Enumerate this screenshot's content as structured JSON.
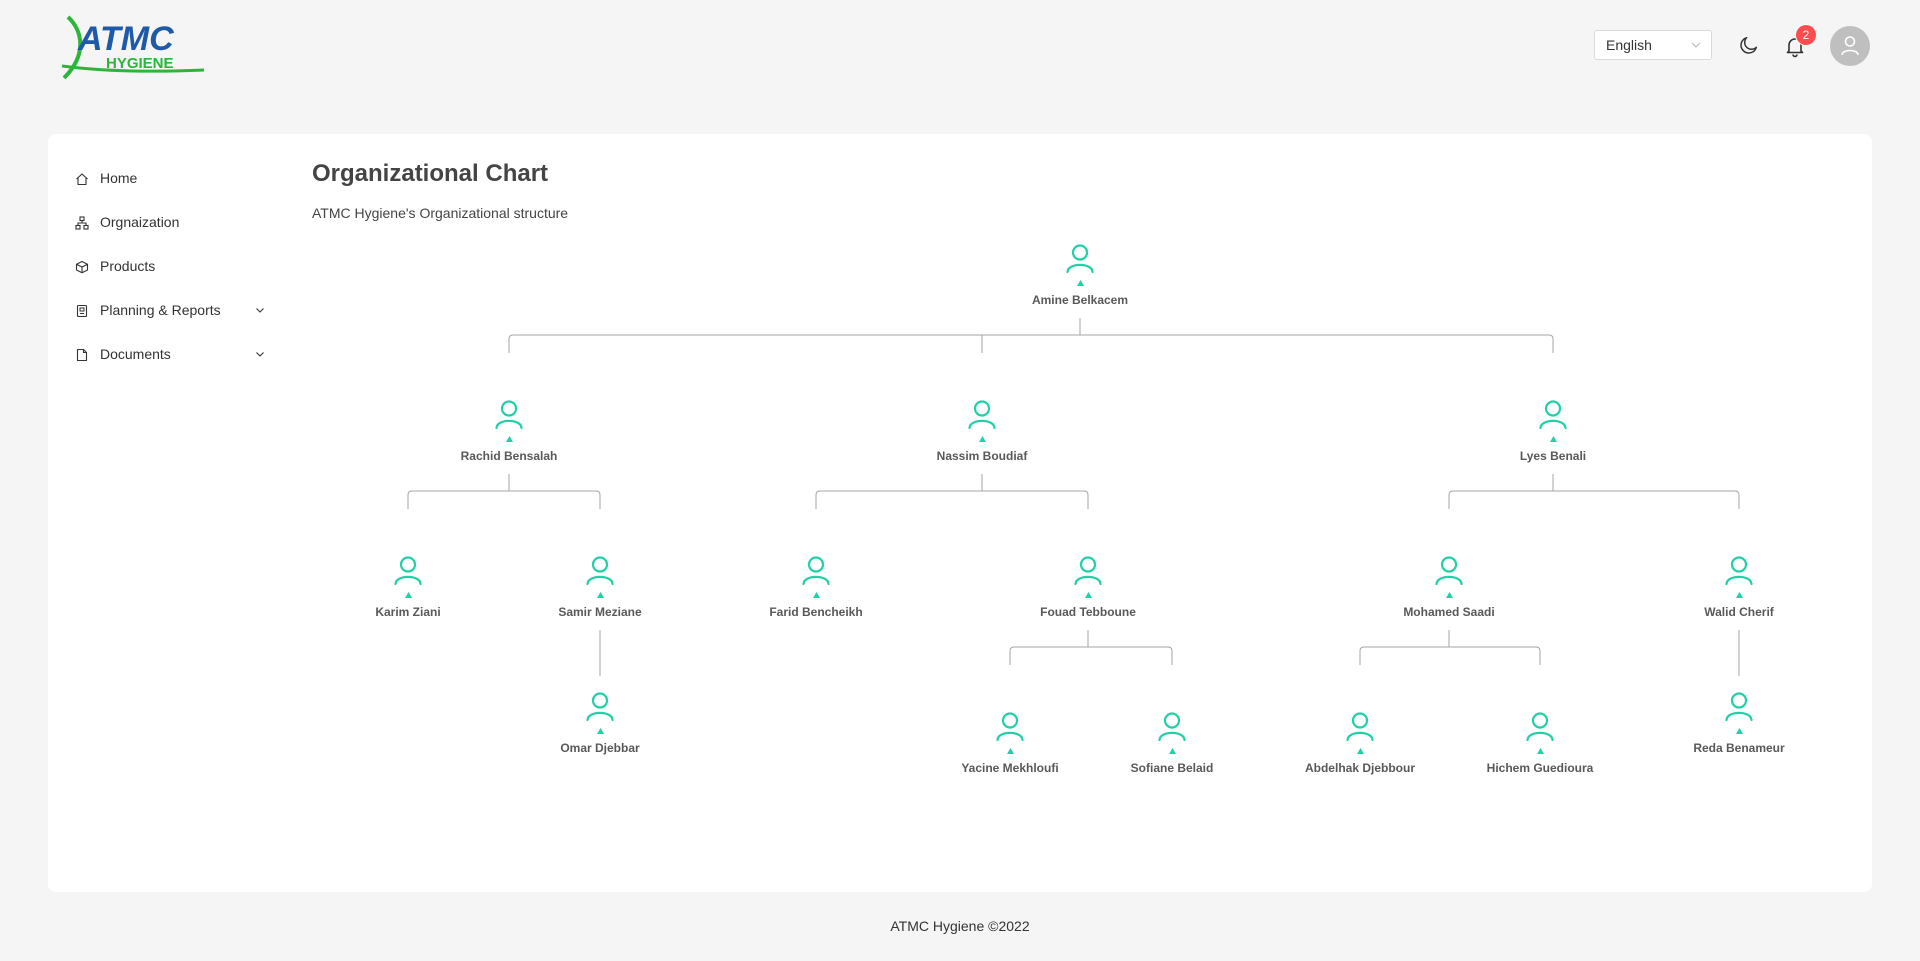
{
  "header": {
    "logo": {
      "text_main": "ATMC",
      "text_sub": "HYGIENE"
    },
    "language": {
      "selected": "English"
    },
    "notifications": {
      "count": "2"
    },
    "icons": {
      "theme": "moon-icon",
      "notifications": "bell-icon",
      "avatar": "user-icon"
    }
  },
  "sidebar": {
    "items": [
      {
        "label": "Home",
        "icon": "home-icon"
      },
      {
        "label": "Orgnaization",
        "icon": "org-tree-icon"
      },
      {
        "label": "Products",
        "icon": "box-icon"
      },
      {
        "label": "Planning & Reports",
        "icon": "report-icon",
        "expandable": true
      },
      {
        "label": "Documents",
        "icon": "document-icon",
        "expandable": true
      }
    ]
  },
  "main": {
    "title": "Organizational Chart",
    "subtitle": "ATMC Hygiene's Organizational structure"
  },
  "org_chart": {
    "name": "Amine Belkacem",
    "children": [
      {
        "name": "Rachid Bensalah",
        "children": [
          {
            "name": "Karim Ziani"
          },
          {
            "name": "Samir Meziane",
            "children": [
              {
                "name": "Omar Djebbar"
              }
            ]
          }
        ]
      },
      {
        "name": "Nassim Boudiaf",
        "children": [
          {
            "name": "Farid Bencheikh"
          },
          {
            "name": "Fouad Tebboune",
            "children": [
              {
                "name": "Yacine Mekhloufi"
              },
              {
                "name": "Sofiane Belaid"
              }
            ]
          }
        ]
      },
      {
        "name": "Lyes Benali",
        "children": [
          {
            "name": "Mohamed Saadi",
            "children": [
              {
                "name": "Abdelhak Djebbour"
              },
              {
                "name": "Hichem Guedioura"
              }
            ]
          },
          {
            "name": "Walid Cherif",
            "children": [
              {
                "name": "Reda Benameur"
              }
            ]
          }
        ]
      }
    ]
  },
  "colors": {
    "accent": "#1fd1a6",
    "line": "#a6a6a6",
    "badge": "#ff4d4f"
  },
  "footer": {
    "text": "ATMC Hygiene ©2022"
  }
}
